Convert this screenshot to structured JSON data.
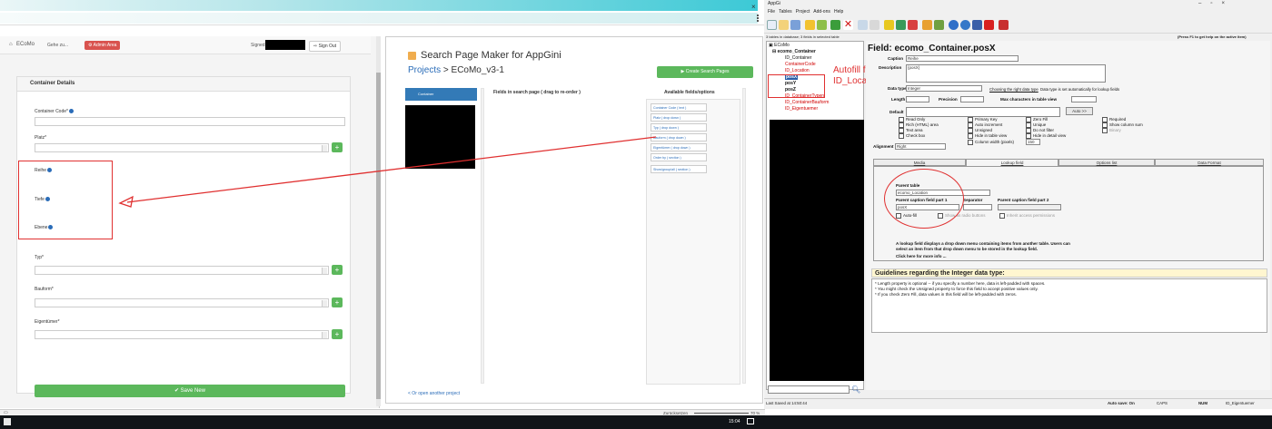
{
  "browser": {
    "close_glyph": "×"
  },
  "ecomo": {
    "brand": "ECoMo",
    "nav_menu": "Gehe zu...",
    "admin_button": "Admin Area",
    "signed_label": "Signed",
    "signout_button": "Sign Out",
    "panel_title": "Container Details",
    "fields": [
      {
        "label": "Container Code*",
        "kind": "text"
      },
      {
        "label": "Platz*",
        "kind": "select"
      },
      {
        "label": "Reihe",
        "kind": "static"
      },
      {
        "label": "Tiefe",
        "kind": "static"
      },
      {
        "label": "Ebene",
        "kind": "static"
      },
      {
        "label": "Typ*",
        "kind": "select"
      },
      {
        "label": "Bauform*",
        "kind": "select"
      },
      {
        "label": "Eigentümer*",
        "kind": "select"
      }
    ],
    "save_button": "Save New",
    "plus_glyph": "+"
  },
  "spm": {
    "title": "Search Page Maker for AppGini",
    "breadcrumb_link": "Projects",
    "breadcrumb_rest": " > ECoMo_v3-1",
    "create_button": "Create Search Pages",
    "table_item": "Container",
    "fields_heading": "Fields in search page ( drag to re-order )",
    "available_heading": "Available fields/options",
    "available_items": [
      "Container Code ( text )",
      "Platz ( drop down )",
      "Typ ( drop down )",
      "Bauform ( drop down )",
      "Eigentümer ( drop down )",
      "Order by ( section )",
      "Show/group/all ( section )"
    ],
    "open_project": "< Or open another project"
  },
  "appgini": {
    "title": "AppGi",
    "menu": [
      "File",
      "Tables",
      "Project",
      "Add-ons",
      "Help"
    ],
    "status_top": "3 tables in database; 3 fields in selected table",
    "help_hint": "(Press F1 to get help on the active item)",
    "tree": [
      {
        "label": "ECoMo",
        "level": 0,
        "color": "#111"
      },
      {
        "label": "ecomo_Container",
        "level": 1,
        "color": "#111"
      },
      {
        "label": "ID_Container",
        "level": 2,
        "color": "#111"
      },
      {
        "label": "ContainerCode",
        "level": 2,
        "color": "#d00000"
      },
      {
        "label": "ID_Location",
        "level": 2,
        "color": "#d00000"
      },
      {
        "label": "posX",
        "level": 2,
        "color": "#111"
      },
      {
        "label": "posY",
        "level": 2,
        "color": "#111"
      },
      {
        "label": "posZ",
        "level": 2,
        "color": "#111"
      },
      {
        "label": "ID_ContainerTypen",
        "level": 2,
        "color": "#d00000"
      },
      {
        "label": "ID_ContainerBauform",
        "level": 2,
        "color": "#d00000"
      },
      {
        "label": "ID_Eigentuemer",
        "level": 2,
        "color": "#d00000"
      }
    ],
    "annotation_line1": "Autofill from",
    "annotation_line2": "ID_Location",
    "field_title": "Field: ecomo_Container.posX",
    "caption_label": "Caption",
    "caption_value": "Reihe",
    "description_label": "Description",
    "description_value": "{posX}",
    "datatype_label": "Data type",
    "datatype_value": "Integer",
    "datatype_link": "Choosing the right data type",
    "datatype_note": "Data type is set automatically for lookup fields",
    "length_label": "Length",
    "precision_label": "Precision",
    "maxchars_label": "Max characters in table view",
    "default_label": "Default",
    "auto_button": "Auto >>",
    "checkboxes_col1": [
      "Read Only",
      "Rich (HTML) area",
      "Text area",
      "Check box"
    ],
    "checkboxes_col2": [
      "Primary Key",
      "Auto increment",
      "Unsigned",
      "Hide in table view",
      "Column width (pixels)"
    ],
    "checkboxes_col3": [
      "Zero Fill",
      "Unique",
      "Do not filter",
      "Hide in detail view"
    ],
    "checkboxes_col4": [
      "Required",
      "Show column sum",
      "Binary"
    ],
    "column_width_value": "150",
    "alignment_label": "Alignment",
    "alignment_value": "Right",
    "tabs": [
      "Media",
      "Lookup field",
      "Options list",
      "Data Format"
    ],
    "parent_table_label": "Parent table",
    "parent_table_value": "ecomo_Location",
    "caption_part1_label": "Parent caption field part 1",
    "separator_label": "Separator",
    "caption_part2_label": "Parent caption field part 2",
    "caption_part1_value": "posX",
    "autofill_label": "Auto-fill",
    "radio_label": "Show as radio buttons",
    "inherit_label": "Inherit access permissions",
    "lookup_desc": "A lookup field displays a drop down menu containing items from another table. Users can select an item from that drop down menu to be stored in the lookup field.",
    "lookup_more": "Click here for more info ...",
    "guide_title": "Guidelines regarding the Integer data type:",
    "guide_lines": [
      "* Length property is optional -- if you specify a number here, data is left-padded with spaces.",
      "* You might check the Unsigned property to force this field to accept positive values only.",
      "* If you check Zero Fill, data values in this field will be left-padded with zeros."
    ],
    "status_saved": "Last Saved at 14:50:44",
    "status_autosave": "Auto save: On",
    "status_caps": "CAPS",
    "status_num": "NUM",
    "status_field": "ID_Eigentuemer"
  },
  "bottom": {
    "zoom_label": "Zurücksetzen",
    "zoom_value": "70 %"
  },
  "taskbar": {
    "clock": "15:04"
  },
  "colors": {
    "accent_green": "#5cb85c",
    "accent_red": "#d9534f",
    "annotation_red": "#e03030",
    "spm_blue": "#337ab7"
  }
}
